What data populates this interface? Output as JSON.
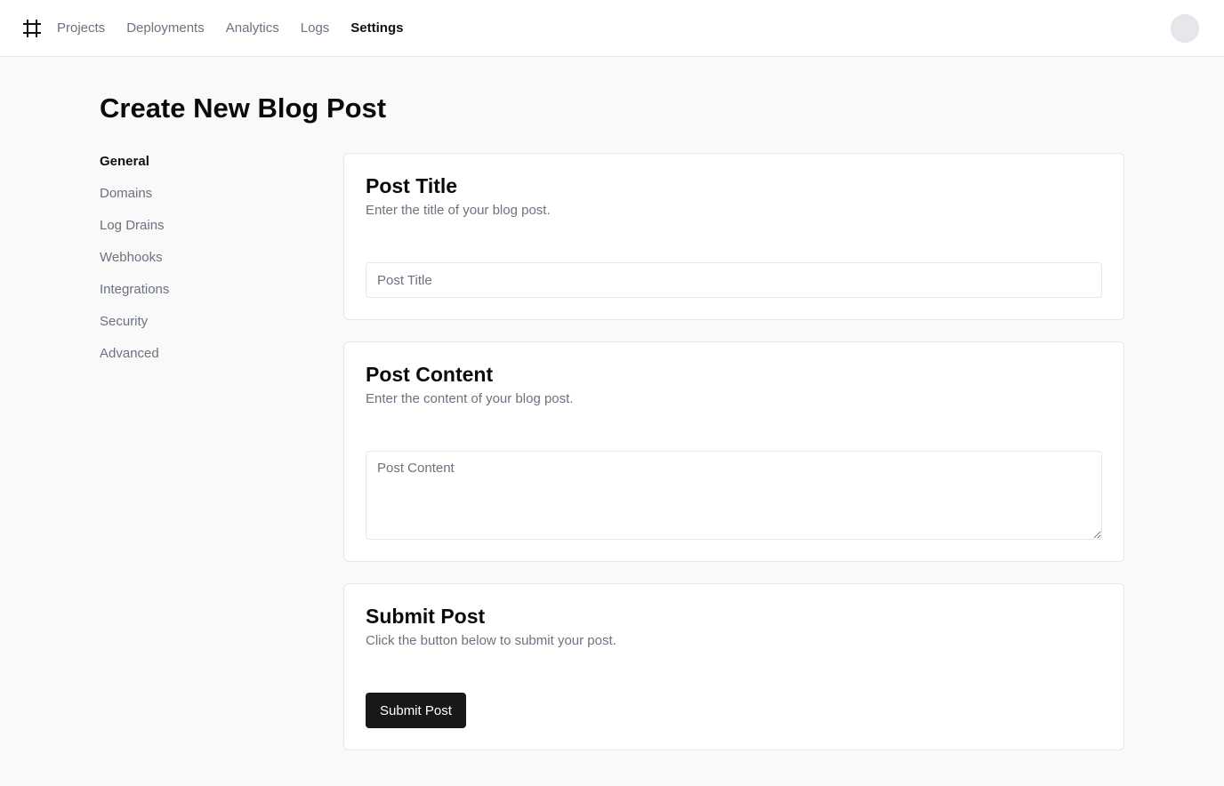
{
  "header": {
    "logo_icon": "hash-grid-icon",
    "nav": [
      {
        "label": "Projects"
      },
      {
        "label": "Deployments"
      },
      {
        "label": "Analytics"
      },
      {
        "label": "Logs"
      },
      {
        "label": "Settings",
        "active": true
      }
    ],
    "avatar_icon": "user-avatar"
  },
  "page": {
    "title": "Create New Blog Post"
  },
  "sidebar": {
    "items": [
      {
        "label": "General",
        "active": true
      },
      {
        "label": "Domains"
      },
      {
        "label": "Log Drains"
      },
      {
        "label": "Webhooks"
      },
      {
        "label": "Integrations"
      },
      {
        "label": "Security"
      },
      {
        "label": "Advanced"
      }
    ]
  },
  "title_card": {
    "title": "Post Title",
    "description": "Enter the title of your blog post.",
    "input_placeholder": "Post Title",
    "input_value": ""
  },
  "content_card": {
    "title": "Post Content",
    "description": "Enter the content of your blog post.",
    "textarea_placeholder": "Post Content",
    "textarea_value": ""
  },
  "submit_card": {
    "title": "Submit Post",
    "description": "Click the button below to submit your post.",
    "button_label": "Submit Post"
  },
  "colors": {
    "page_background": "#f8f9f8",
    "primary_button": "#18181b",
    "muted_text": "#6b7280"
  }
}
